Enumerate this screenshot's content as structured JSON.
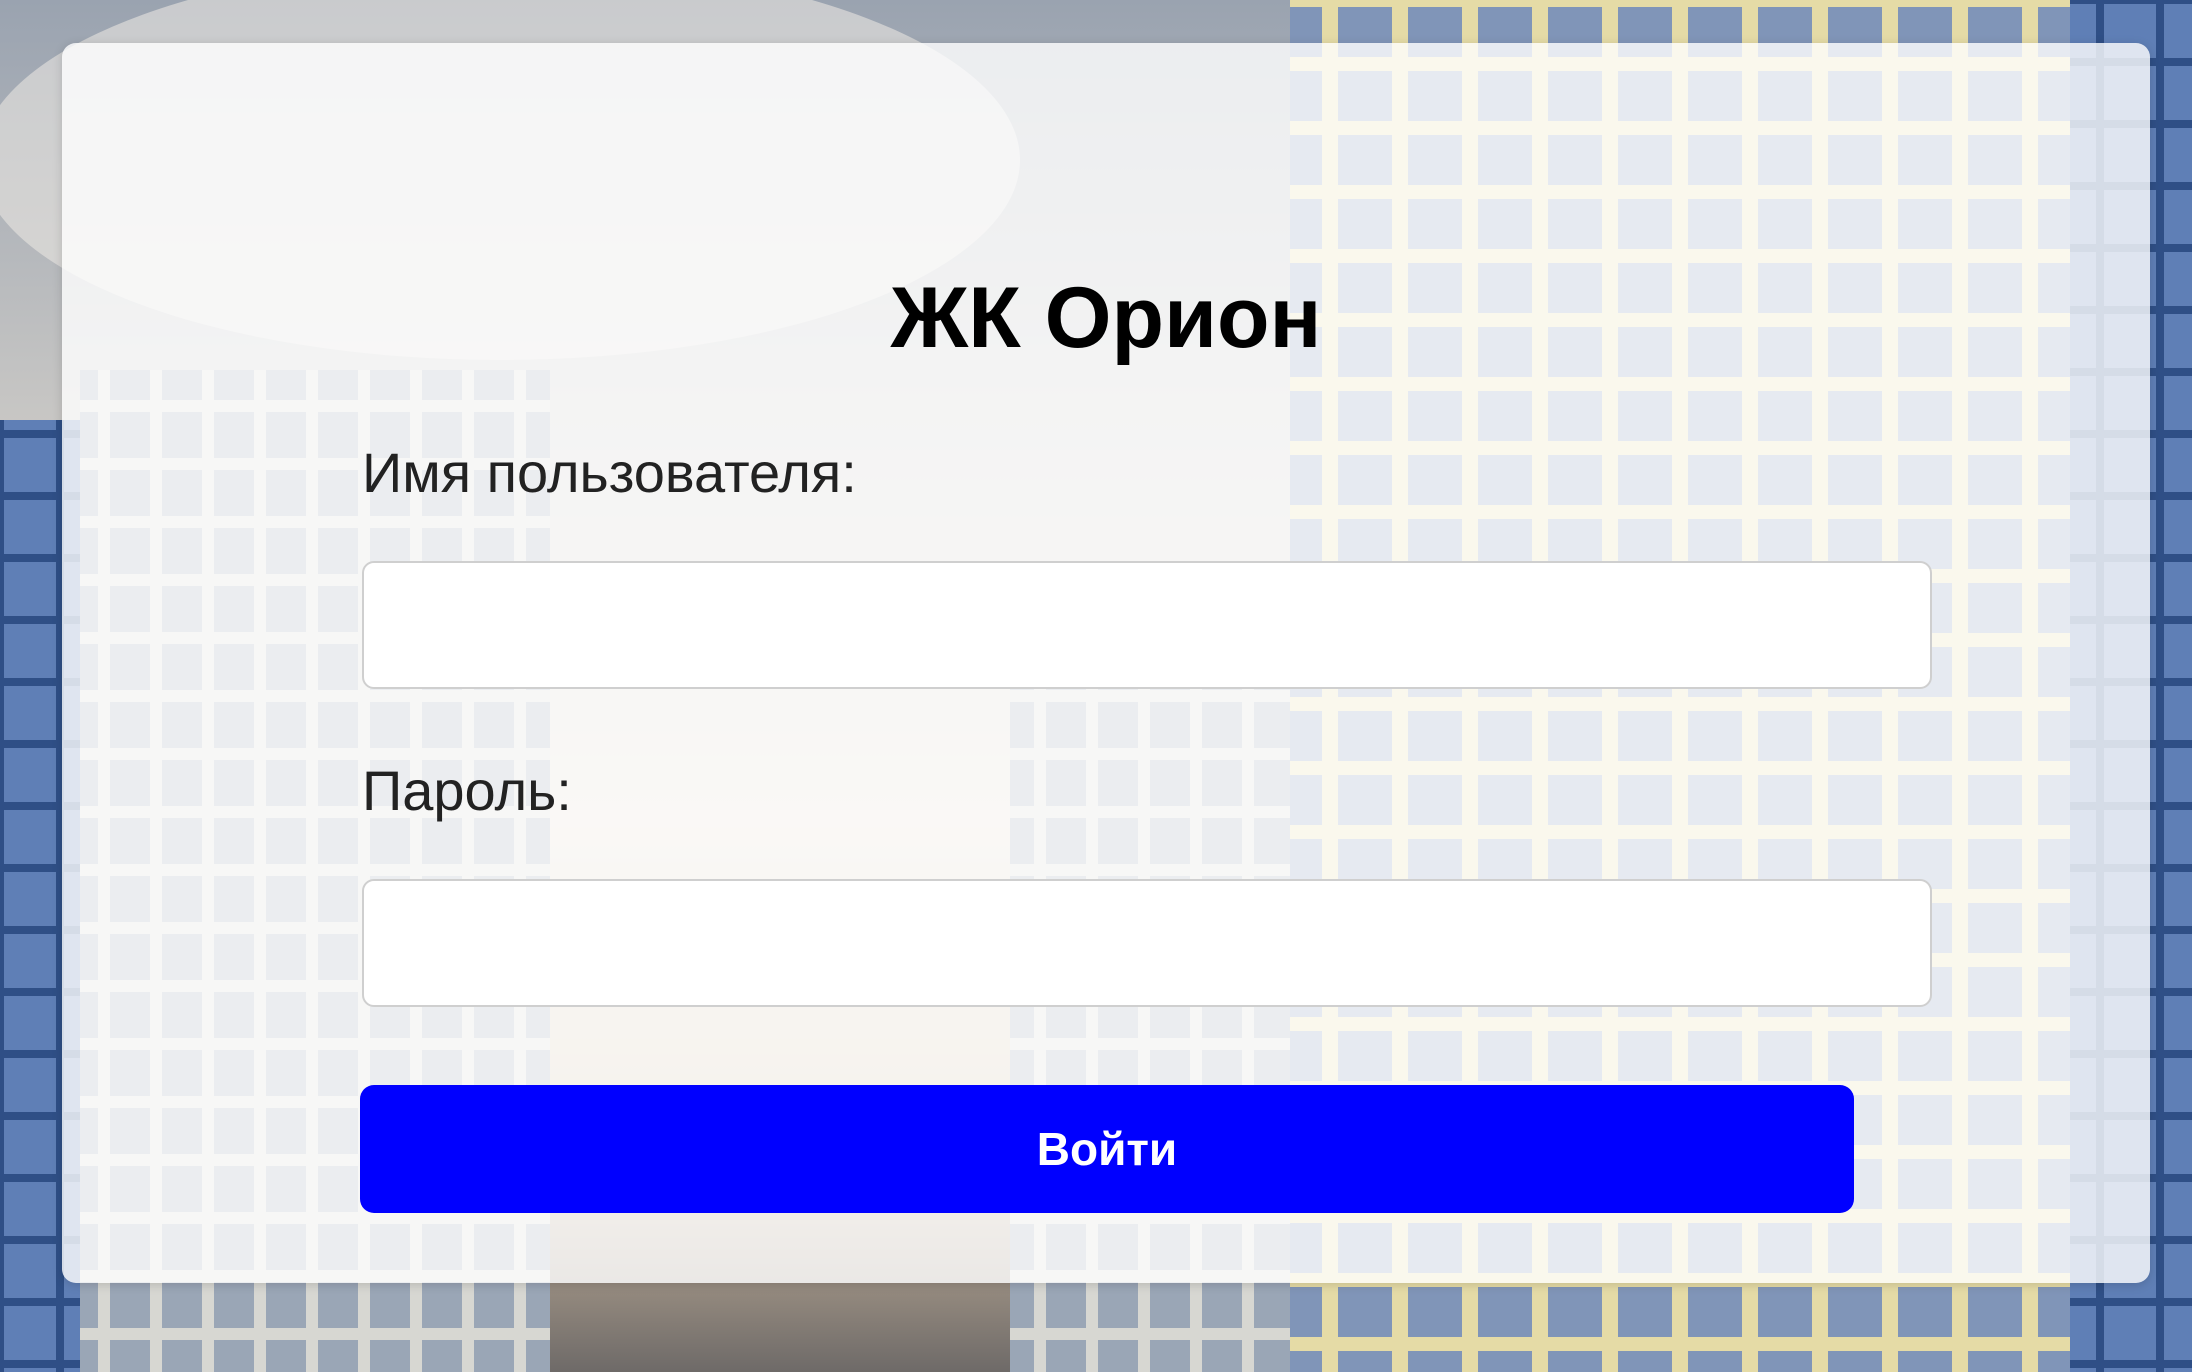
{
  "login": {
    "title": "ЖК Орион",
    "username_label": "Имя пользователя:",
    "username_value": "",
    "password_label": "Пароль:",
    "password_value": "",
    "submit_label": "Войти"
  },
  "colors": {
    "accent": "#0000ff",
    "card_background": "rgba(255,255,255,0.8)"
  }
}
